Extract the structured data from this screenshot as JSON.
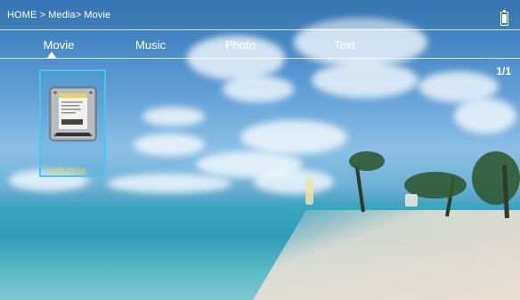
{
  "header": {
    "breadcrumb": "HOME > Media> Movie",
    "battery_icon": "battery-icon"
  },
  "tabs": [
    {
      "label": "Movie",
      "selected": true
    },
    {
      "label": "Music"
    },
    {
      "label": "Photo"
    },
    {
      "label": "Text"
    }
  ],
  "page_indicator": "1/1",
  "items": [
    {
      "label": "USB DISK",
      "icon": "hard-disk-icon",
      "selected": true
    }
  ],
  "colors": {
    "selection_border": "#47c7f0",
    "item_label": "#f4d43b",
    "text": "#ffffff"
  }
}
